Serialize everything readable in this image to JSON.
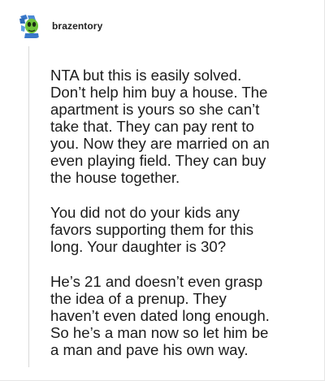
{
  "post": {
    "username": "brazentory",
    "avatar_icon": "alien-avatar-icon",
    "paragraphs": [
      "NTA but this is easily solved.\nDon’t help him buy a house. The\napartment is yours so she can’t\ntake that. They can pay rent to\nyou. Now they are married on an\neven playing field. They can buy\nthe house together.",
      "You did not do your kids any\nfavors supporting them for this\nlong. Your daughter is 30?",
      "He’s 21 and doesn’t even grasp\nthe idea of a prenup. They\nhaven’t even dated long enough.\nSo he’s a man now so let him be\na man and pave his own way."
    ]
  },
  "colors": {
    "background": "#ffffff",
    "text": "#1c1c1c",
    "thread_line": "#d9d9d9",
    "avatar_green": "#6fc23a",
    "avatar_blue": "#3a78c9"
  }
}
